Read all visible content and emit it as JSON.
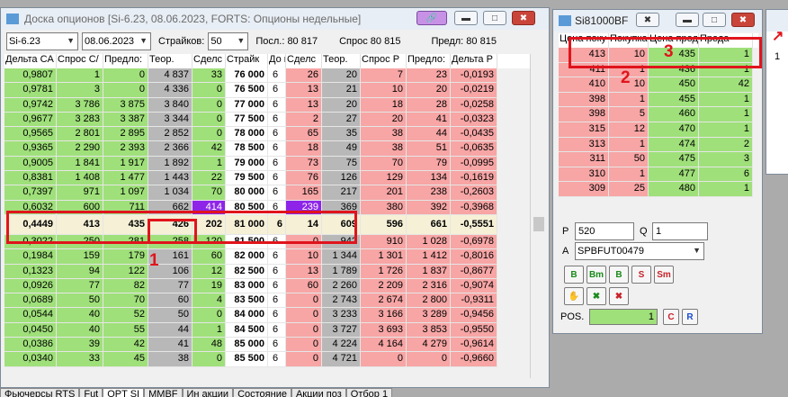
{
  "board": {
    "title": "Доска опционов [Si-6.23, 08.06.2023, FORTS: Опционы недельные]",
    "instrument": "Si-6.23",
    "date": "08.06.2023",
    "strikes_label": "Страйков:",
    "strikes_value": "50",
    "last_label": "Посл.: 80 817",
    "bid_label": "Спрос 80 815",
    "prev_label": "Предл: 80 815",
    "headers": [
      "Дельта CA",
      "Спрос С/",
      "Предло:",
      "Теор.",
      "Сделс",
      "Страйк",
      "До и",
      "Сделс",
      "Теор.",
      "Спрос Р",
      "Предло:",
      "Дельта Р"
    ],
    "rows": [
      [
        "0,9807",
        "1",
        "0",
        "4 837",
        "33",
        "76 000",
        "6",
        "26",
        "20",
        "7",
        "23",
        "-0,0193"
      ],
      [
        "0,9781",
        "3",
        "0",
        "4 336",
        "0",
        "76 500",
        "6",
        "13",
        "21",
        "10",
        "20",
        "-0,0219"
      ],
      [
        "0,9742",
        "3 786",
        "3 875",
        "3 840",
        "0",
        "77 000",
        "6",
        "13",
        "20",
        "18",
        "28",
        "-0,0258"
      ],
      [
        "0,9677",
        "3 283",
        "3 387",
        "3 344",
        "0",
        "77 500",
        "6",
        "2",
        "27",
        "20",
        "41",
        "-0,0323"
      ],
      [
        "0,9565",
        "2 801",
        "2 895",
        "2 852",
        "0",
        "78 000",
        "6",
        "65",
        "35",
        "38",
        "44",
        "-0,0435"
      ],
      [
        "0,9365",
        "2 290",
        "2 393",
        "2 366",
        "42",
        "78 500",
        "6",
        "18",
        "49",
        "38",
        "51",
        "-0,0635"
      ],
      [
        "0,9005",
        "1 841",
        "1 917",
        "1 892",
        "1",
        "79 000",
        "6",
        "73",
        "75",
        "70",
        "79",
        "-0,0995"
      ],
      [
        "0,8381",
        "1 408",
        "1 477",
        "1 443",
        "22",
        "79 500",
        "6",
        "76",
        "126",
        "129",
        "134",
        "-0,1619"
      ],
      [
        "0,7397",
        "971",
        "1 097",
        "1 034",
        "70",
        "80 000",
        "6",
        "165",
        "217",
        "201",
        "238",
        "-0,2603"
      ],
      [
        "0,6032",
        "600",
        "711",
        "662",
        "414",
        "80 500",
        "6",
        "239",
        "369",
        "380",
        "392",
        "-0,3968"
      ],
      [
        "0,4449",
        "413",
        "435",
        "426",
        "202",
        "81 000",
        "6",
        "14",
        "609",
        "596",
        "661",
        "-0,5551"
      ],
      [
        "0,3022",
        "250",
        "281",
        "258",
        "120",
        "81 500",
        "6",
        "0",
        "942",
        "910",
        "1 028",
        "-0,6978"
      ],
      [
        "0,1984",
        "159",
        "179",
        "161",
        "60",
        "82 000",
        "6",
        "10",
        "1 344",
        "1 301",
        "1 412",
        "-0,8016"
      ],
      [
        "0,1323",
        "94",
        "122",
        "106",
        "12",
        "82 500",
        "6",
        "13",
        "1 789",
        "1 726",
        "1 837",
        "-0,8677"
      ],
      [
        "0,0926",
        "77",
        "82",
        "77",
        "19",
        "83 000",
        "6",
        "60",
        "2 260",
        "2 209",
        "2 316",
        "-0,9074"
      ],
      [
        "0,0689",
        "50",
        "70",
        "60",
        "4",
        "83 500",
        "6",
        "0",
        "2 743",
        "2 674",
        "2 800",
        "-0,9311"
      ],
      [
        "0,0544",
        "40",
        "52",
        "50",
        "0",
        "84 000",
        "6",
        "0",
        "3 233",
        "3 166",
        "3 289",
        "-0,9456"
      ],
      [
        "0,0450",
        "40",
        "55",
        "44",
        "1",
        "84 500",
        "6",
        "0",
        "3 727",
        "3 693",
        "3 853",
        "-0,9550"
      ],
      [
        "0,0386",
        "39",
        "42",
        "41",
        "48",
        "85 000",
        "6",
        "0",
        "4 224",
        "4 164",
        "4 279",
        "-0,9614"
      ],
      [
        "0,0340",
        "33",
        "45",
        "38",
        "0",
        "85 500",
        "6",
        "0",
        "4 721",
        "0",
        "0",
        "-0,9660"
      ]
    ]
  },
  "glass": {
    "title": "Si81000BF",
    "headers": [
      "Цена поку",
      "Покупка",
      "Цена прод",
      "Прода"
    ],
    "rows": [
      [
        "413",
        "10",
        "435",
        "1"
      ],
      [
        "411",
        "1",
        "436",
        "1"
      ],
      [
        "410",
        "10",
        "450",
        "42"
      ],
      [
        "398",
        "1",
        "455",
        "1"
      ],
      [
        "398",
        "5",
        "460",
        "1"
      ],
      [
        "315",
        "12",
        "470",
        "1"
      ],
      [
        "313",
        "1",
        "474",
        "2"
      ],
      [
        "311",
        "50",
        "475",
        "3"
      ],
      [
        "310",
        "1",
        "477",
        "6"
      ],
      [
        "309",
        "25",
        "480",
        "1"
      ]
    ],
    "p_label": "P",
    "p_value": "520",
    "q_label": "Q",
    "q_value": "1",
    "a_label": "A",
    "account": "SPBFUT00479",
    "buttons": [
      "B",
      "Bm",
      "B",
      "S",
      "Sm"
    ],
    "pos_label": "POS.",
    "pos_value": "1",
    "c_label": "C",
    "r_label": "R"
  },
  "third": {
    "row_label": "1"
  },
  "tabs": [
    "Фьючерсы RTS",
    "Fut",
    "OPT SI",
    "MMBF",
    "Ин акции",
    "Состояние",
    "Акции поз",
    "Отбор 1"
  ],
  "annotations": {
    "a1": "1",
    "a2": "2",
    "a3": "3"
  },
  "colors": {
    "green": "#9fe07a",
    "red": "#f7a5a5",
    "grey": "#b8b8b8",
    "highlight": "#e0141c",
    "purple": "#8e24e8"
  }
}
